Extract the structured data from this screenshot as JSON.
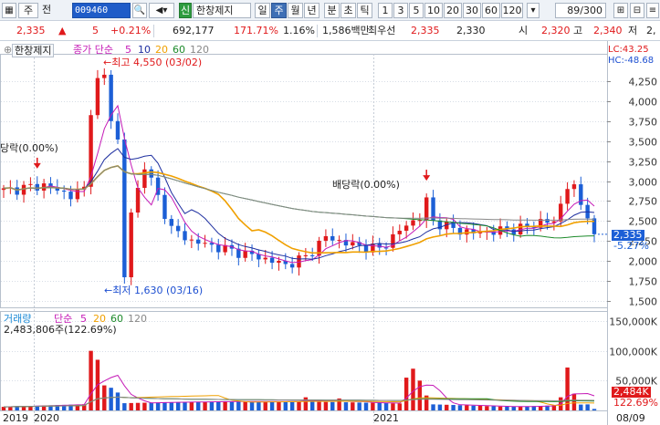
{
  "toolbar": {
    "market": "주",
    "mode": "전",
    "code": "009460",
    "badge": "신",
    "stock_name": "한창제지",
    "periods": [
      "일",
      "주",
      "월",
      "년",
      "분",
      "초",
      "틱"
    ],
    "active_period": "주",
    "numbers": [
      "1",
      "3",
      "5",
      "10",
      "20",
      "30",
      "60",
      "120"
    ],
    "count": "89/300"
  },
  "quote": {
    "price": "2,335",
    "direction": "▲",
    "change": "5",
    "change_pct": "+0.21%",
    "volume": "692,177",
    "volume_ratio": "171.71%",
    "turnover": "1.16%",
    "amount": "1,586백만",
    "prior_label": "최우선",
    "bid1": "2,335",
    "bid2": "2,330",
    "open_label": "시",
    "open": "2,320",
    "high_label": "고",
    "high": "2,340",
    "low_label": "저",
    "low": "2,"
  },
  "price_panel": {
    "title": "한창제지",
    "ma_label": "종가 단순",
    "ma_periods": [
      "5",
      "10",
      "20",
      "60",
      "120"
    ],
    "ma_colors": [
      "#c51bb7",
      "#1e2fa0",
      "#f0a000",
      "#1c8a2a",
      "#888888"
    ],
    "lc": "LC:43.25",
    "hc": "HC:-48.68",
    "current_price": "2,335",
    "current_pct": "-5.27%",
    "annotation_high": "최고 4,550 (03/02)",
    "annotation_low": "최저 1,630 (03/16)",
    "annotation_div1": "당락(0.00%)",
    "annotation_div2": "배당락(0.00%)",
    "y_ticks": [
      "4,250",
      "4,000",
      "3,750",
      "3,500",
      "3,250",
      "3,000",
      "2,750",
      "2,500",
      "2,250",
      "2,000",
      "1,750",
      "1,500"
    ]
  },
  "volume_panel": {
    "title": "거래량",
    "ma_label": "단순",
    "ma_periods": [
      "5",
      "20",
      "60",
      "120"
    ],
    "ma_colors": [
      "#c51bb7",
      "#f0a000",
      "#1c8a2a",
      "#888888"
    ],
    "peak_label": "2,483,806주(122.69%)",
    "current_volume": "2,484K",
    "current_pct": "122.69%",
    "y_ticks": [
      "150,000K",
      "100,000K",
      "50,000K"
    ]
  },
  "x_axis": {
    "labels": [
      "2019",
      "2020",
      "2021"
    ],
    "last_date": "08/09"
  },
  "colors": {
    "up": "#e0191b",
    "down": "#1c5fd6",
    "grid": "#d7dde6",
    "axis_bg": "#ffffff"
  }
}
